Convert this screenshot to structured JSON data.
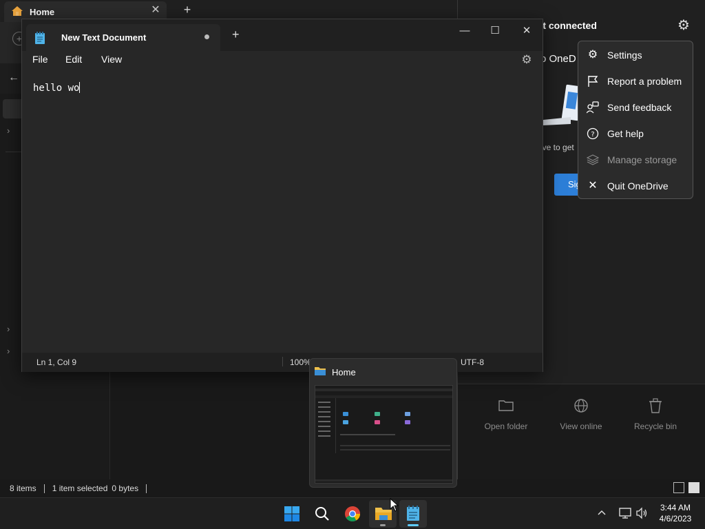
{
  "explorer": {
    "tab_title": "Home",
    "tab_close": "✕",
    "new_tab": "+",
    "status": {
      "items": "8 items",
      "selected": "1 item selected",
      "size": "0 bytes"
    }
  },
  "onedrive": {
    "status_title": "'t connected",
    "welcome": "o OneD",
    "subtitle": "ive to get",
    "signin_label": "Sig",
    "menu": [
      {
        "label": "Settings",
        "icon": "gear-icon",
        "enabled": true
      },
      {
        "label": "Report a problem",
        "icon": "flag-icon",
        "enabled": true
      },
      {
        "label": "Send feedback",
        "icon": "feedback-icon",
        "enabled": true
      },
      {
        "label": "Get help",
        "icon": "help-icon",
        "enabled": true
      },
      {
        "label": "Manage storage",
        "icon": "storage-icon",
        "enabled": false
      },
      {
        "label": "Quit OneDrive",
        "icon": "close-icon",
        "enabled": true
      }
    ],
    "actions": [
      {
        "label": "Open folder",
        "icon": "folder-icon"
      },
      {
        "label": "View online",
        "icon": "globe-icon"
      },
      {
        "label": "Recycle bin",
        "icon": "recycle-bin-icon"
      }
    ]
  },
  "notepad": {
    "tab_title": "New Text Document",
    "new_tab": "+",
    "menus": [
      "File",
      "Edit",
      "View"
    ],
    "content": "hello wo",
    "status": {
      "position": "Ln 1, Col 9",
      "zoom": "100%",
      "encoding": "UTF-8"
    },
    "controls": {
      "minimize": "—",
      "maximize": "☐",
      "close": "✕"
    }
  },
  "thumbnail": {
    "title": "Home"
  },
  "taskbar": {
    "time": "3:44 AM",
    "date": "4/6/2023",
    "tray_chevron": "^"
  },
  "colors": {
    "accent": "#60cdff",
    "signin_blue": "#2d7fd8",
    "windows_blue": "#0078d4"
  }
}
